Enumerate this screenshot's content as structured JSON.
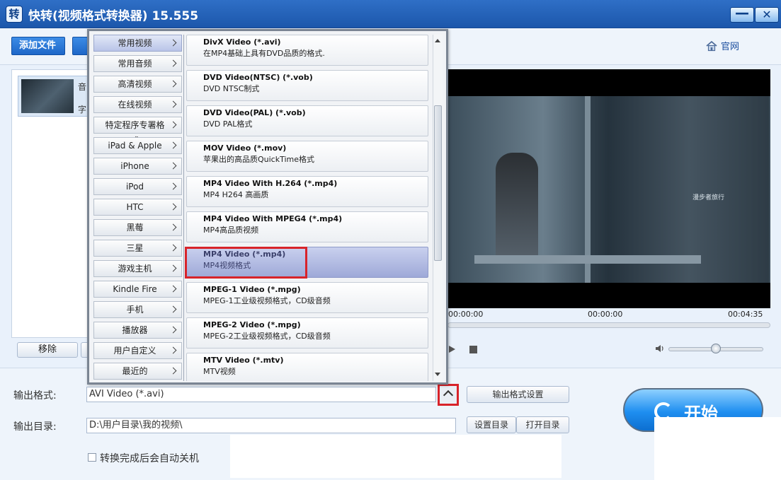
{
  "window": {
    "title": "快转(视频格式转换器) 15.555",
    "icon_char": "转",
    "min_label": "—",
    "close_label": "✕"
  },
  "toolbar": {
    "add_file": "添加文件",
    "website": "官网"
  },
  "file_list": {
    "item_label_1": "音",
    "item_label_2": "字"
  },
  "left_actions": {
    "remove": "移除"
  },
  "player": {
    "time_left": "00:00:00",
    "time_mid": "00:00:00",
    "time_right": "00:04:35",
    "subtitle_tag": "漫步者旅行",
    "volume_level": 0.5
  },
  "popup": {
    "categories": [
      {
        "label": "常用视频",
        "active": true
      },
      {
        "label": "常用音频"
      },
      {
        "label": "高清视频"
      },
      {
        "label": "在线视频"
      },
      {
        "label": "特定程序专署格式"
      },
      {
        "label": "iPad & Apple TV"
      },
      {
        "label": "iPhone"
      },
      {
        "label": "iPod"
      },
      {
        "label": "HTC"
      },
      {
        "label": "黑莓"
      },
      {
        "label": "三星"
      },
      {
        "label": "游戏主机"
      },
      {
        "label": "Kindle Fire"
      },
      {
        "label": "手机"
      },
      {
        "label": "播放器"
      },
      {
        "label": "用户自定义"
      },
      {
        "label": "最近的"
      }
    ],
    "formats": [
      {
        "title": "DivX Video (*.avi)",
        "desc": "在MP4基础上具有DVD品质的格式."
      },
      {
        "title": "DVD Video(NTSC) (*.vob)",
        "desc": "DVD  NTSC制式"
      },
      {
        "title": "DVD Video(PAL) (*.vob)",
        "desc": "DVD PAL格式"
      },
      {
        "title": "MOV Video (*.mov)",
        "desc": "苹果出的高品质QuickTime格式"
      },
      {
        "title": "MP4 Video With H.264 (*.mp4)",
        "desc": "MP4  H264 高画质"
      },
      {
        "title": "MP4 Video With MPEG4 (*.mp4)",
        "desc": "MP4高品质视频"
      },
      {
        "title": "MP4 Video (*.mp4)",
        "desc": "MP4视频格式",
        "selected": true
      },
      {
        "title": "MPEG-1 Video (*.mpg)",
        "desc": "MPEG-1工业级视频格式，CD级音频"
      },
      {
        "title": "MPEG-2 Video (*.mpg)",
        "desc": "MPEG-2工业级视频格式，CD级音频"
      },
      {
        "title": "MTV Video (*.mtv)",
        "desc": "MTV视频"
      }
    ]
  },
  "output": {
    "format_label": "输出格式:",
    "format_value": "AVI Video (*.avi)",
    "format_settings": "输出格式设置",
    "dir_label": "输出目录:",
    "dir_value": "D:\\用户目录\\我的视频\\",
    "set_dir": "设置目录",
    "open_dir": "打开目录",
    "shutdown_label": "转换完成后会自动关机"
  },
  "start": {
    "label": "开始"
  },
  "colors": {
    "title_bar": "#1c57ab",
    "accent_red": "#d8232a",
    "selected_item": "#9ea9d8"
  }
}
